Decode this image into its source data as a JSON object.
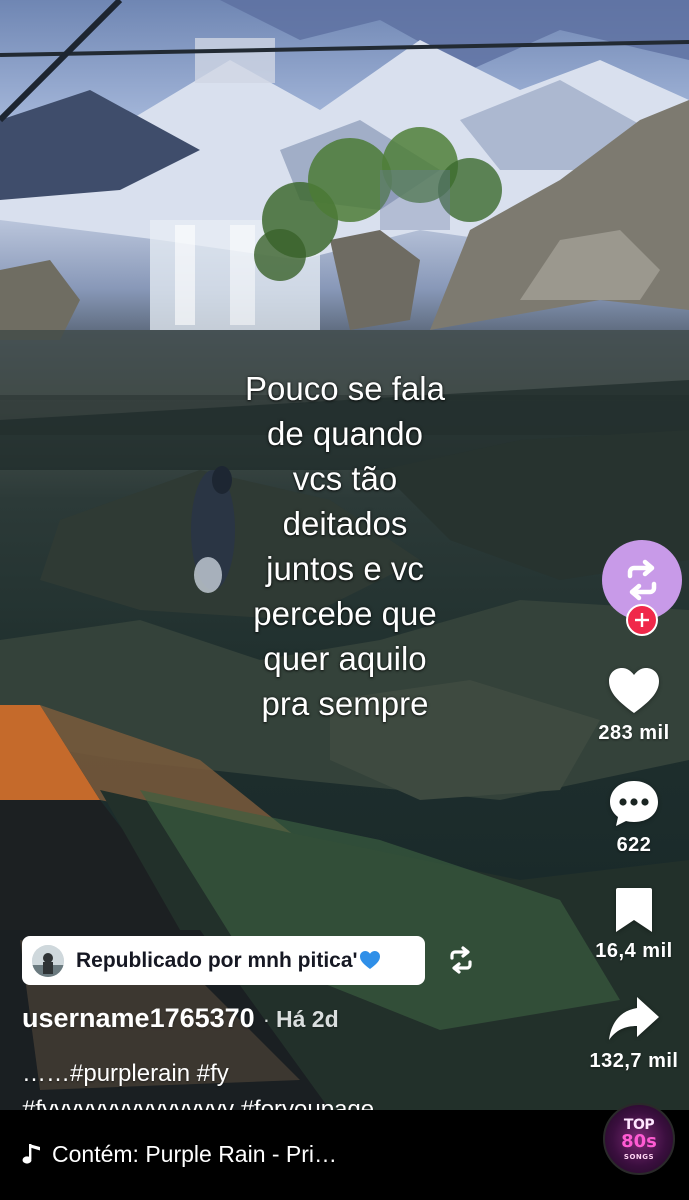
{
  "video": {
    "caption_lines": [
      "Pouco se fala",
      "de quando",
      "vcs tão",
      "deitados",
      "juntos e vc",
      "percebe que",
      "quer aquilo",
      "pra sempre"
    ]
  },
  "actions": {
    "likes": "283 mil",
    "comments": "622",
    "saves": "16,4 mil",
    "shares": "132,7 mil"
  },
  "repost": {
    "label": "Republicado por mnh pitica'"
  },
  "post": {
    "username": "username1765370",
    "separator": "·",
    "time": "Há 2d",
    "description_line1": "……#purplerain #fy",
    "description_line2": "#fyyyyyyyyyyyyyyyy #foryoupage"
  },
  "music": {
    "label": "Contém: Purple Rain - Pri…",
    "disc_text_top": "TOP",
    "disc_text_mid": "80s",
    "disc_text_bottom": "SONGS"
  },
  "colors": {
    "repost_avatar_bg": "#c89ae8",
    "follow_plus": "#f0284a",
    "heart_blue": "#2f8fe8"
  },
  "icons": {
    "repost": "repost-arrows-icon",
    "plus": "plus-icon",
    "like": "heart-icon",
    "comment": "comment-bubble-icon",
    "save": "bookmark-icon",
    "share": "share-arrow-icon",
    "music": "music-note-icon"
  }
}
